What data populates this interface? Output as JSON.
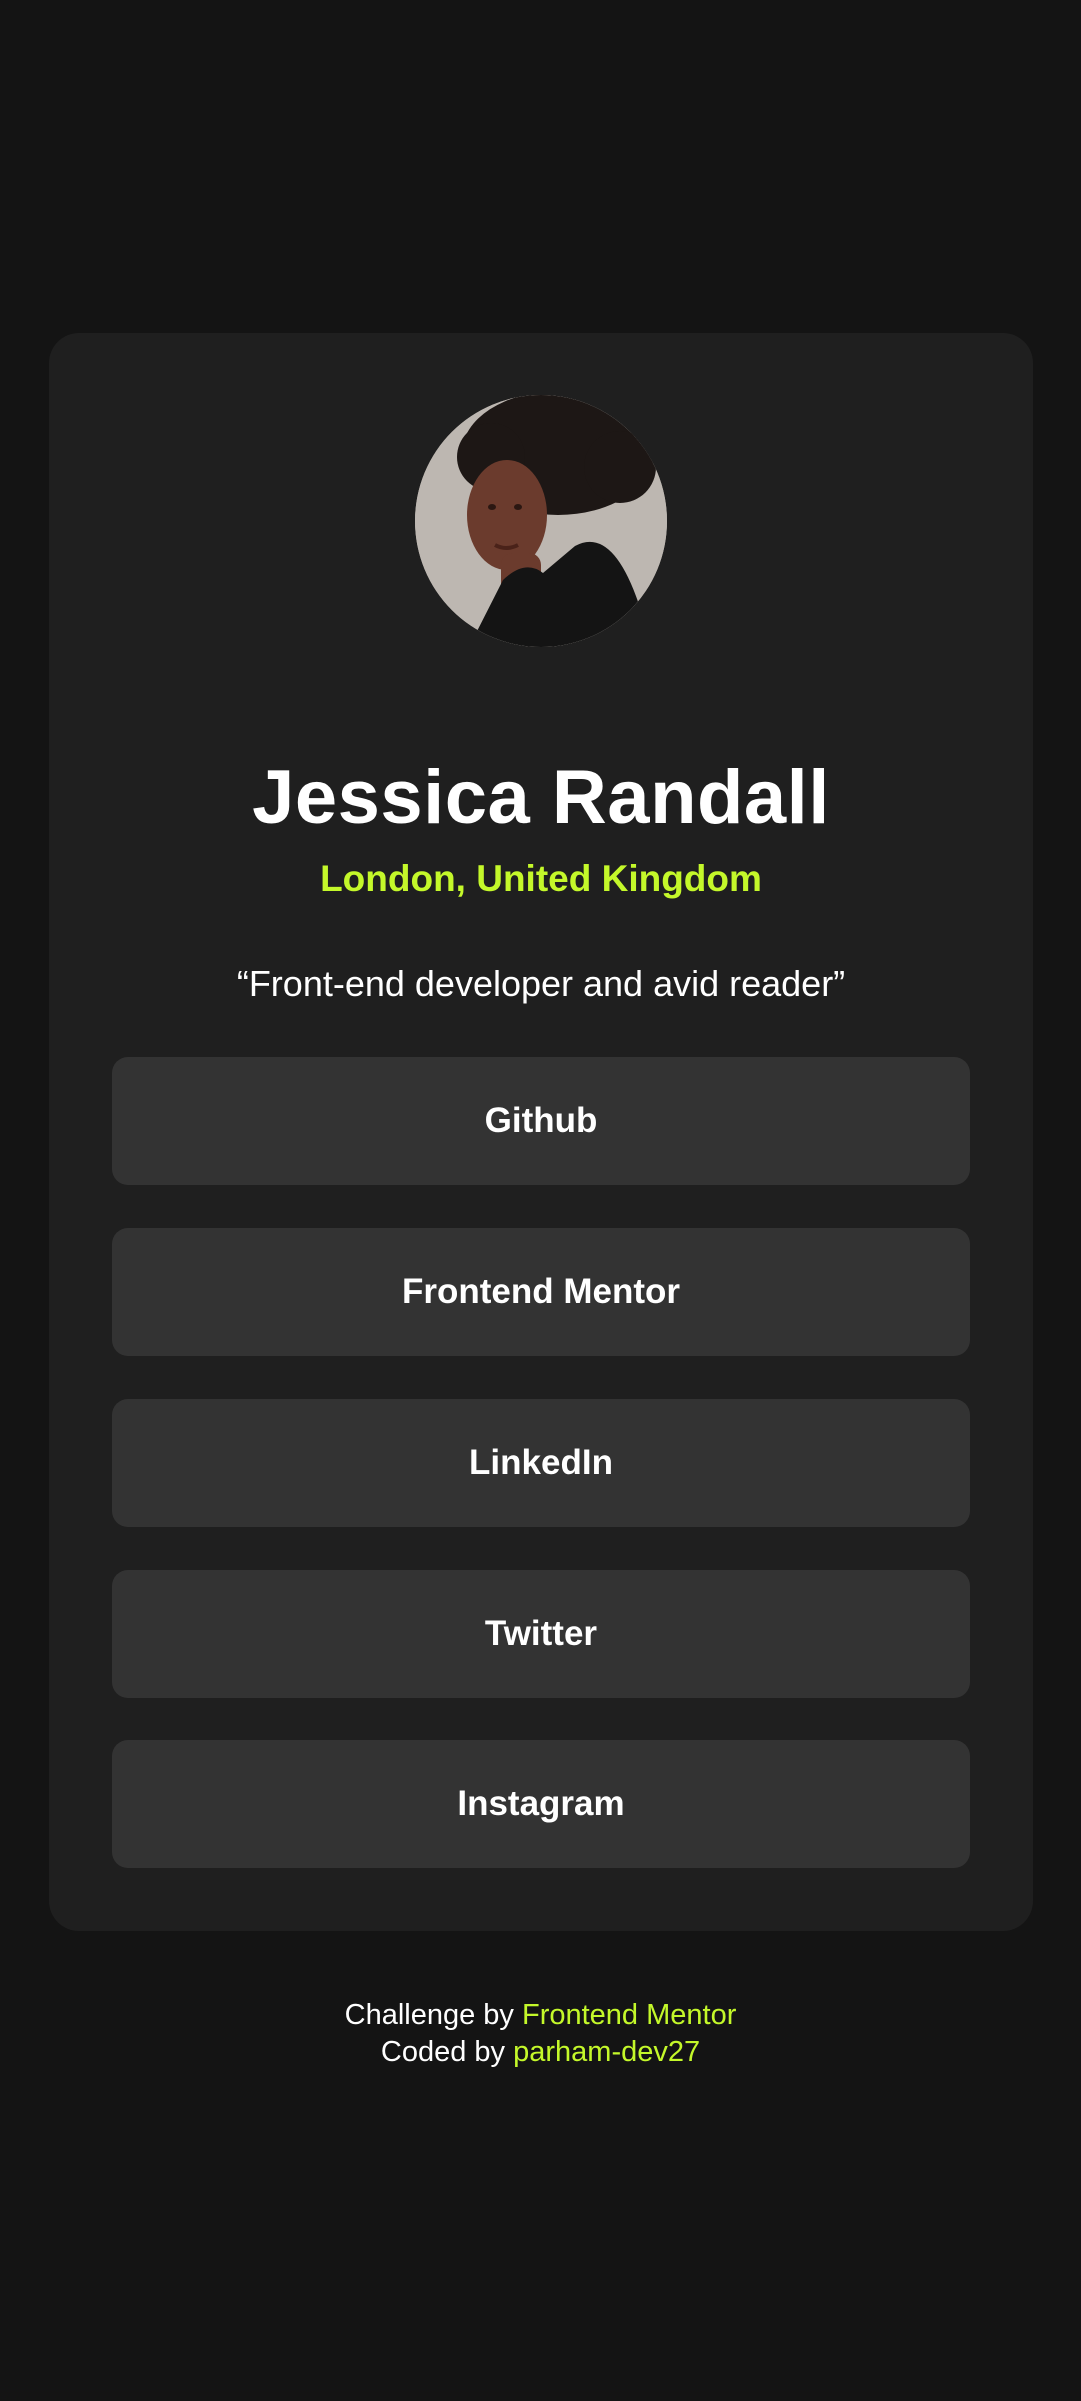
{
  "profile": {
    "avatar_icon": "profile-photo",
    "name": "Jessica Randall",
    "location": "London, United Kingdom",
    "bio": "“Front-end developer and avid reader”"
  },
  "links": [
    {
      "label": "Github"
    },
    {
      "label": "Frontend Mentor"
    },
    {
      "label": "LinkedIn"
    },
    {
      "label": "Twitter"
    },
    {
      "label": "Instagram"
    }
  ],
  "footer": {
    "challenge_prefix": "Challenge by",
    "challenge_link": "Frontend Mentor",
    "coded_prefix": "Coded by",
    "coded_link": "parham-dev27"
  },
  "colors": {
    "background": "#141414",
    "card": "#1f1f1f",
    "button": "#333333",
    "accent": "#c4f82a",
    "text": "#ffffff"
  }
}
